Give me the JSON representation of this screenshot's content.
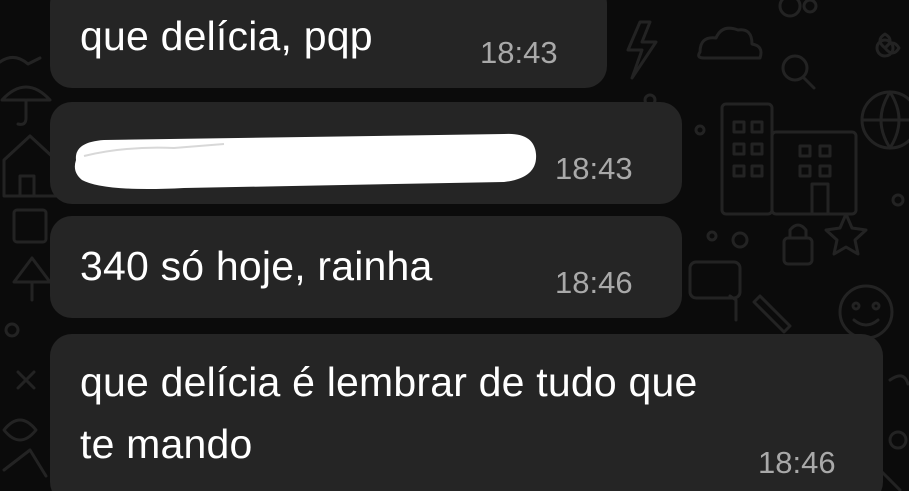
{
  "theme": {
    "background": "#0b0b0b",
    "bubble_color": "#252525",
    "text_color": "#ffffff",
    "time_color": "#a9a9a9",
    "redaction_color": "#ffffff"
  },
  "wallpaper": {
    "icons": [
      "lightning-icon",
      "cloud-icon",
      "magnifier-icon",
      "buildings-icon",
      "globe-icon",
      "flower-icon",
      "lock-icon",
      "smiley-face-icon",
      "pencil-icon",
      "tree-icon",
      "house-icon",
      "umbrella-icon"
    ]
  },
  "messages": [
    {
      "text": "que delícia, pqp",
      "time": "18:43"
    },
    {
      "text": "",
      "redacted": true,
      "time": "18:43"
    },
    {
      "text": "340 só hoje, rainha",
      "time": "18:46"
    },
    {
      "line1": "que delícia é lembrar de tudo que",
      "line2": "te mando",
      "time": "18:46"
    }
  ]
}
